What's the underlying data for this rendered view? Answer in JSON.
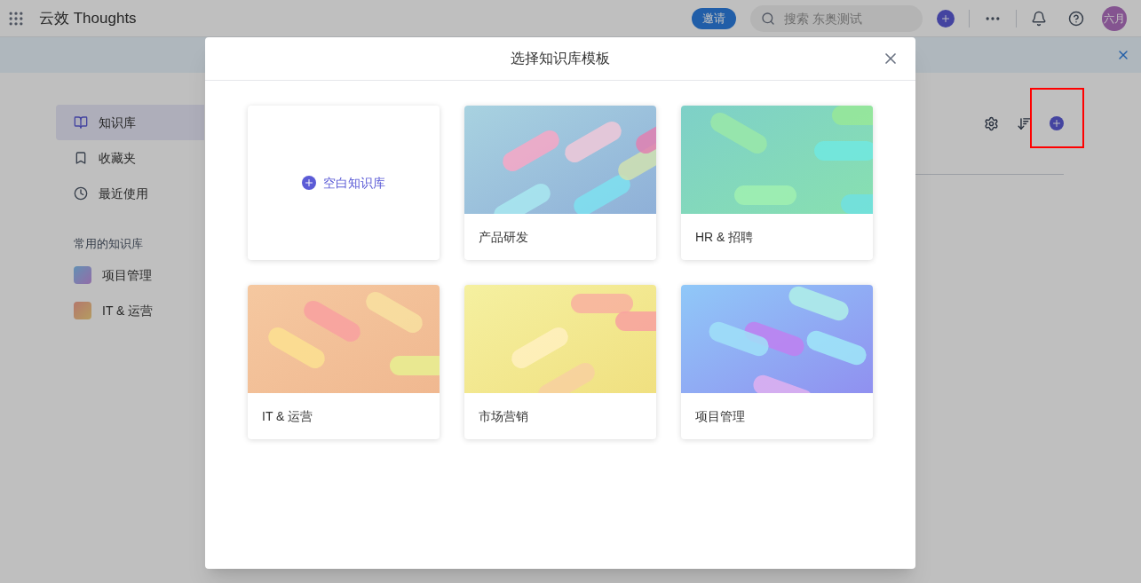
{
  "app": {
    "title": "云效 Thoughts"
  },
  "header": {
    "invite": "邀请",
    "search": {
      "placeholder": "搜索 东奥测试"
    },
    "avatar": "六月"
  },
  "sidebar": {
    "items": [
      {
        "label": "知识库",
        "selected": true
      },
      {
        "label": "收藏夹",
        "selected": false
      },
      {
        "label": "最近使用",
        "selected": false
      }
    ],
    "section_title": "常用的知识库",
    "favorites": [
      {
        "label": "项目管理"
      },
      {
        "label": "IT & 运营"
      }
    ]
  },
  "modal": {
    "title": "选择知识库模板",
    "templates": [
      {
        "kind": "blank",
        "label": "空白知识库"
      },
      {
        "kind": "template",
        "label": "产品研发"
      },
      {
        "kind": "template",
        "label": "HR & 招聘"
      },
      {
        "kind": "template",
        "label": "IT & 运营"
      },
      {
        "kind": "template",
        "label": "市场营销"
      },
      {
        "kind": "template",
        "label": "项目管理"
      }
    ]
  }
}
